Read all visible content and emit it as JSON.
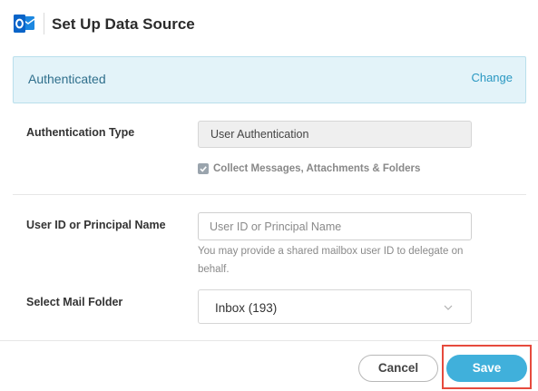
{
  "header": {
    "title": "Set Up Data Source",
    "logo_icon": "outlook-icon",
    "logo_color": "#0a64c8"
  },
  "auth_banner": {
    "status": "Authenticated",
    "change_label": "Change"
  },
  "authentication": {
    "label": "Authentication Type",
    "value": "User Authentication",
    "collect_checkbox": {
      "label": "Collect Messages, Attachments & Folders",
      "checked": true
    }
  },
  "user_id": {
    "label": "User ID or Principal Name",
    "placeholder": "User ID or Principal Name",
    "value": "",
    "helper": "You may provide a shared mailbox user ID to delegate on behalf."
  },
  "mail_folder": {
    "label": "Select Mail Folder",
    "selected": "Inbox (193)"
  },
  "footer": {
    "cancel_label": "Cancel",
    "save_label": "Save"
  },
  "colors": {
    "accent": "#40b0db",
    "banner_bg": "#e3f3f9",
    "highlight": "#e64a3d"
  }
}
